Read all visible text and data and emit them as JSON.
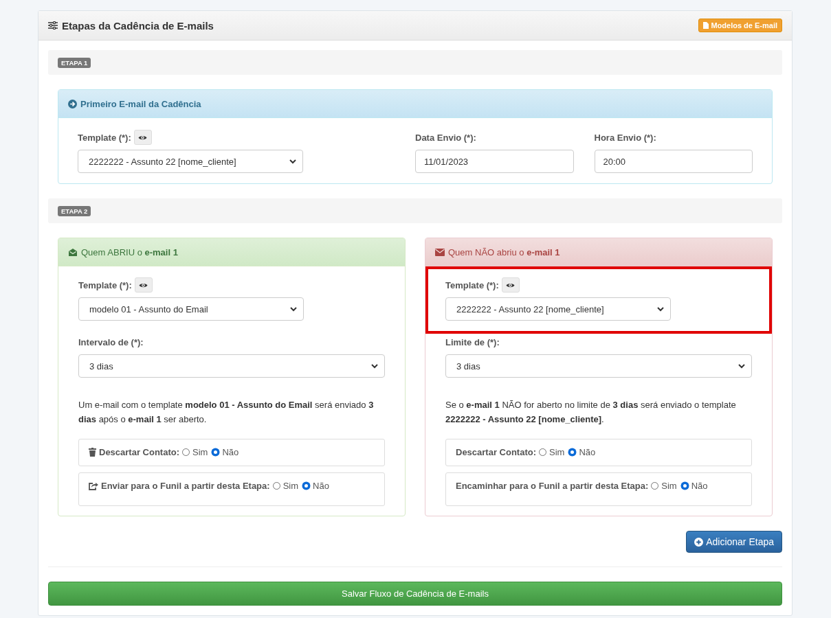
{
  "panel": {
    "title": "Etapas da Cadência de E-mails",
    "templates_button": "Modelos de E-mail"
  },
  "steps": [
    {
      "badge": "ETAPA 1",
      "kind": "single",
      "card": {
        "title": "Primeiro E-mail da Cadência",
        "template": {
          "label": "Template (*):",
          "value": "2222222 - Assunto 22 [nome_cliente]"
        },
        "date": {
          "label": "Data Envio (*):",
          "value": "11/01/2023"
        },
        "time": {
          "label": "Hora Envio (*):",
          "value": "20:00"
        }
      }
    },
    {
      "badge": "ETAPA 2",
      "kind": "branches",
      "branches": [
        {
          "kind": "opened",
          "title": "Quem ABRIU o **e-mail 1**",
          "template": {
            "label": "Template (*):",
            "value": "modelo 01 - Assunto do Email",
            "highlighted": false
          },
          "interval": {
            "label": "Intervalo de (*):",
            "value": "3 dias"
          },
          "summary": "Um e-mail com o template **modelo 01 - Assunto do Email** será enviado **3 dias** após o **e-mail 1** ser aberto.",
          "options": [
            {
              "kind": "discard",
              "label": "Descartar Contato:",
              "choices": [
                {
                  "label": "Sim",
                  "selected": false
                },
                {
                  "label": "Não",
                  "selected": true
                }
              ]
            },
            {
              "kind": "forward",
              "label": "Enviar para o Funil a partir desta Etapa:",
              "choices": [
                {
                  "label": "Sim",
                  "selected": false
                },
                {
                  "label": "Não",
                  "selected": true
                }
              ]
            }
          ]
        },
        {
          "kind": "not_opened",
          "title": "Quem NÃO abriu o **e-mail 1**",
          "template": {
            "label": "Template (*):",
            "value": "2222222 - Assunto 22 [nome_cliente]",
            "highlighted": true
          },
          "interval": {
            "label": "Limite de (*):",
            "value": "3 dias"
          },
          "summary": "Se o **e-mail 1** NÃO for aberto no limite de **3 dias** será enviado o template **2222222 - Assunto 22 [nome_cliente]**.",
          "options": [
            {
              "kind": "plain",
              "label": "Descartar Contato:",
              "choices": [
                {
                  "label": "Sim",
                  "selected": false
                },
                {
                  "label": "Não",
                  "selected": true
                }
              ]
            },
            {
              "kind": "plain",
              "label": "Encaminhar para o Funil a partir desta Etapa:",
              "choices": [
                {
                  "label": "Sim",
                  "selected": false
                },
                {
                  "label": "Não",
                  "selected": true
                }
              ]
            }
          ]
        }
      ]
    }
  ],
  "add_button": "Adicionar Etapa",
  "save_button": "Salvar Fluxo de Cadência de E-mails"
}
